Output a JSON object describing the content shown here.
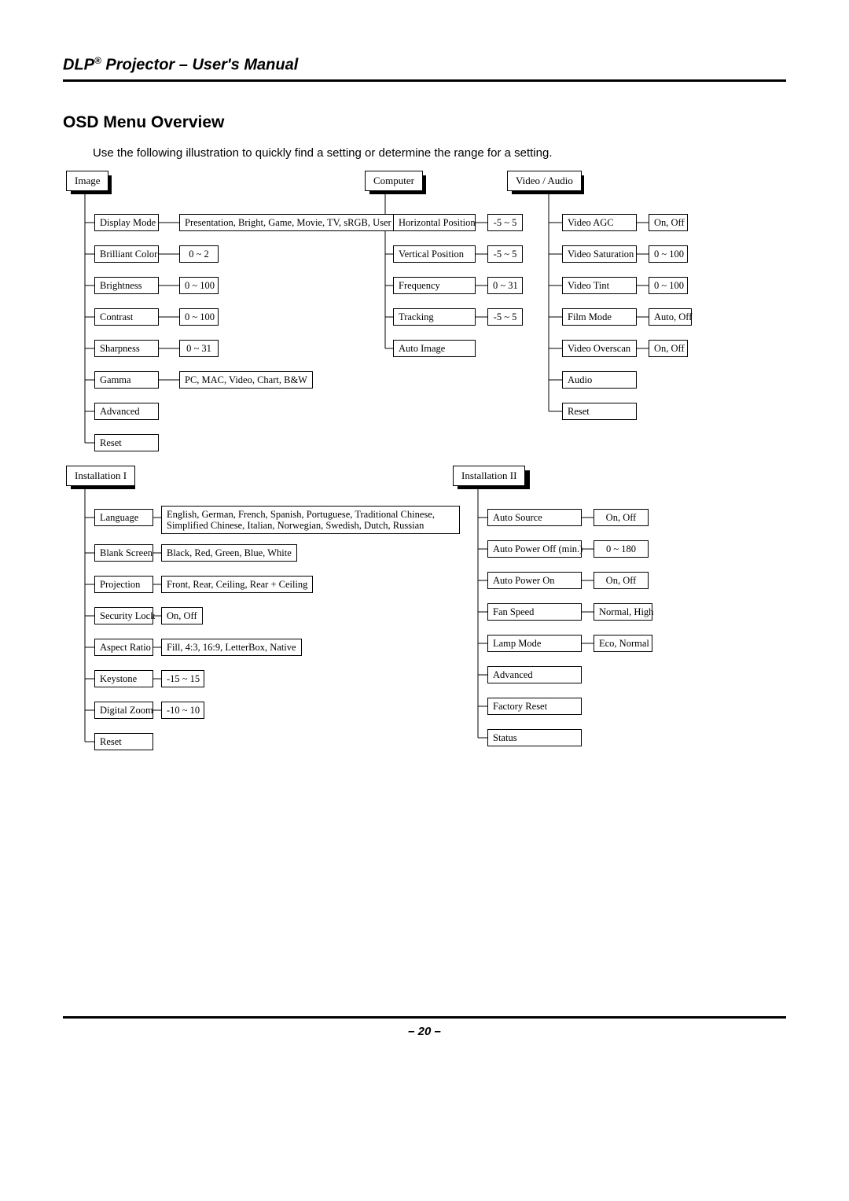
{
  "header": {
    "title_prefix": "DLP",
    "title_suffix": " Projector – User's Manual",
    "reg": "®"
  },
  "section_title": "OSD Menu Overview",
  "intro": "Use the following illustration to quickly find a setting or determine the range for a setting.",
  "page_number": "– 20 –",
  "tabs": {
    "image": "Image",
    "computer": "Computer",
    "videoaudio": "Video / Audio",
    "install1": "Installation I",
    "install2": "Installation  II"
  },
  "image_menu": {
    "display_mode": {
      "label": "Display Mode",
      "value": "Presentation, Bright, Game, Movie, TV, sRGB, User"
    },
    "brilliant_color": {
      "label": "Brilliant Color",
      "value": "0 ~ 2"
    },
    "brightness": {
      "label": "Brightness",
      "value": "0 ~ 100"
    },
    "contrast": {
      "label": "Contrast",
      "value": "0 ~ 100"
    },
    "sharpness": {
      "label": "Sharpness",
      "value": "0 ~ 31"
    },
    "gamma": {
      "label": "Gamma",
      "value": "PC, MAC, Video, Chart, B&W"
    },
    "advanced": {
      "label": "Advanced"
    },
    "reset": {
      "label": "Reset"
    }
  },
  "computer_menu": {
    "hpos": {
      "label": "Horizontal Position",
      "value": "-5 ~ 5"
    },
    "vpos": {
      "label": "Vertical Position",
      "value": "-5 ~ 5"
    },
    "freq": {
      "label": "Frequency",
      "value": "0 ~ 31"
    },
    "track": {
      "label": "Tracking",
      "value": "-5 ~ 5"
    },
    "autoimg": {
      "label": "Auto Image"
    }
  },
  "video_menu": {
    "agc": {
      "label": "Video AGC",
      "value": "On, Off"
    },
    "sat": {
      "label": "Video Saturation",
      "value": "0 ~ 100"
    },
    "tint": {
      "label": "Video Tint",
      "value": "0 ~ 100"
    },
    "film": {
      "label": "Film Mode",
      "value": "Auto, Off"
    },
    "overscan": {
      "label": "Video Overscan",
      "value": "On, Off"
    },
    "audio": {
      "label": "Audio"
    },
    "reset": {
      "label": "Reset"
    }
  },
  "install1_menu": {
    "language": {
      "label": "Language",
      "value": "English, German, French, Spanish, Portuguese, Traditional Chinese, Simplified Chinese, Italian, Norwegian, Swedish, Dutch, Russian"
    },
    "blank": {
      "label": "Blank Screen",
      "value": "Black, Red, Green, Blue, White"
    },
    "proj": {
      "label": "Projection",
      "value": "Front, Rear, Ceiling, Rear + Ceiling"
    },
    "seclock": {
      "label": "Security Lock",
      "value": "On, Off"
    },
    "aspect": {
      "label": "Aspect Ratio",
      "value": "Fill, 4:3, 16:9, LetterBox, Native"
    },
    "keystone": {
      "label": "Keystone",
      "value": "-15 ~ 15"
    },
    "zoom": {
      "label": "Digital Zoom",
      "value": "-10 ~ 10"
    },
    "reset": {
      "label": "Reset"
    }
  },
  "install2_menu": {
    "autosrc": {
      "label": "Auto Source",
      "value": "On, Off"
    },
    "autooff": {
      "label": "Auto Power Off (min.)",
      "value": "0 ~ 180"
    },
    "autoon": {
      "label": "Auto Power On",
      "value": "On, Off"
    },
    "fan": {
      "label": "Fan Speed",
      "value": "Normal, High"
    },
    "lamp": {
      "label": "Lamp Mode",
      "value": "Eco, Normal"
    },
    "advanced": {
      "label": "Advanced"
    },
    "factory": {
      "label": "Factory Reset"
    },
    "status": {
      "label": "Status"
    }
  }
}
